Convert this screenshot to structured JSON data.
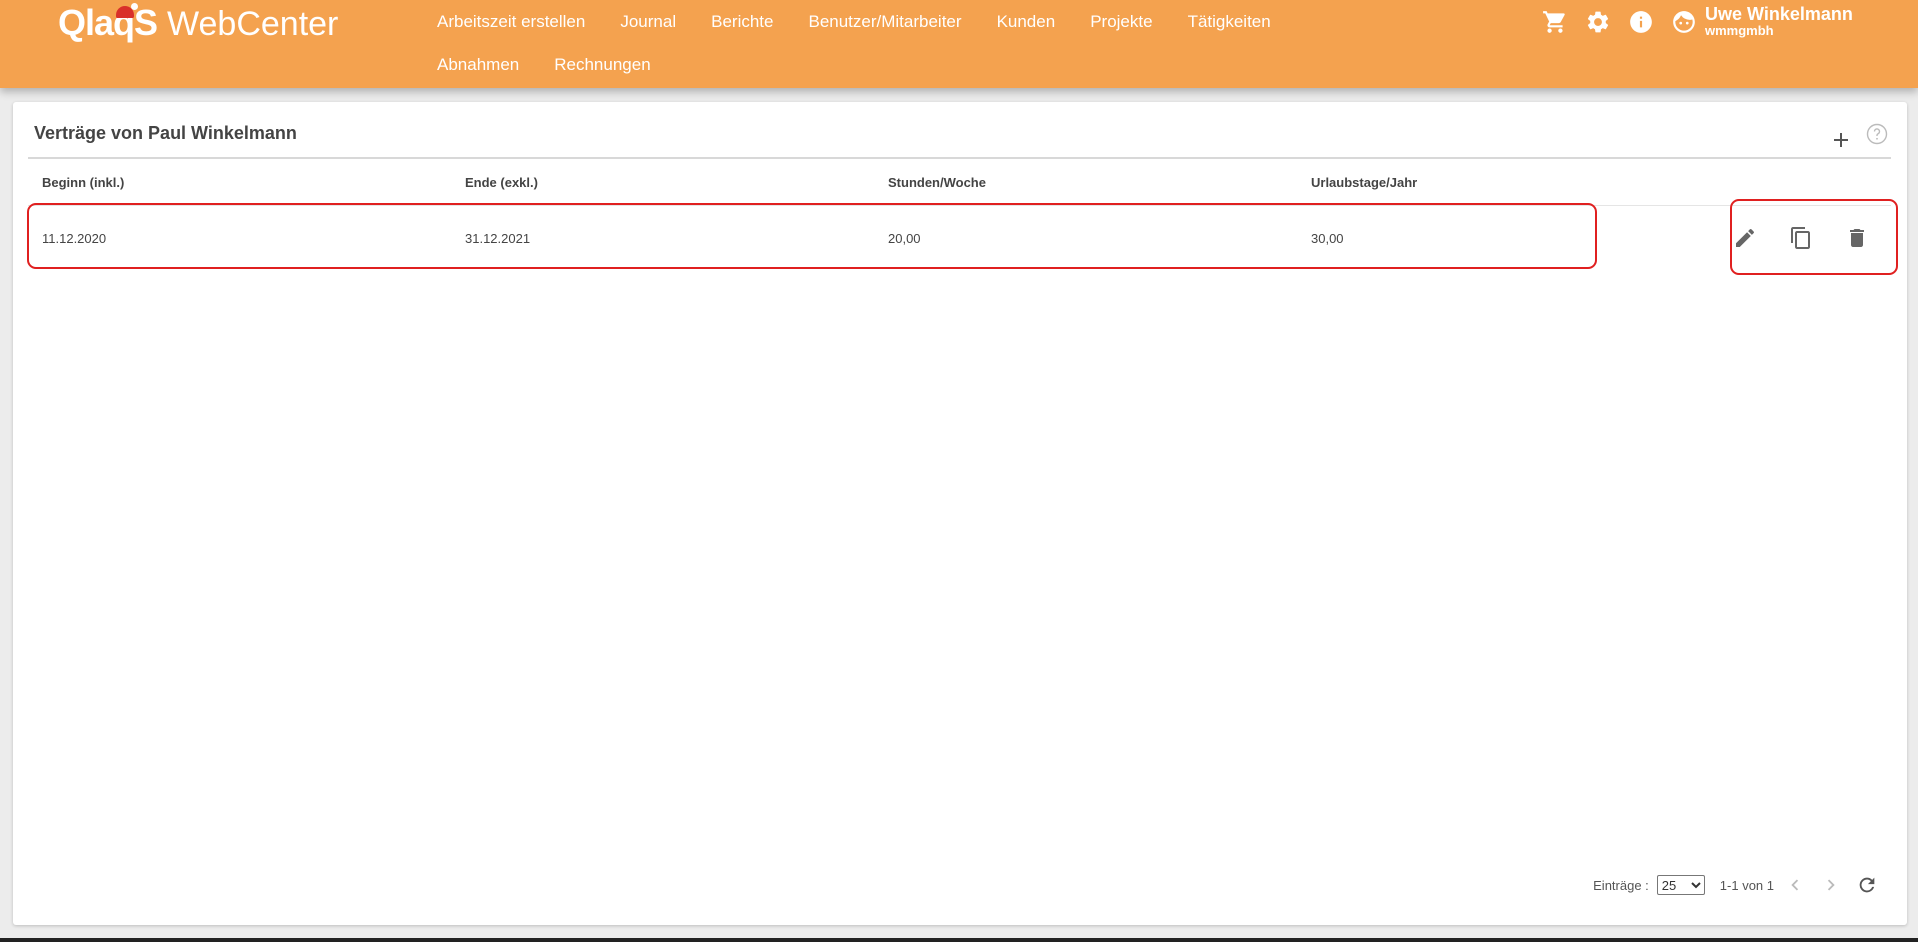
{
  "app": {
    "logo_mark": "QlaqS",
    "logo_text": "WebCenter"
  },
  "nav": {
    "items": [
      "Arbeitszeit erstellen",
      "Journal",
      "Berichte",
      "Benutzer/Mitarbeiter",
      "Kunden",
      "Projekte",
      "Tätigkeiten",
      "Abnahmen",
      "Rechnungen"
    ]
  },
  "user": {
    "name": "Uwe Winkelmann",
    "company": "wmmgmbh"
  },
  "top_icons": [
    "cart-icon",
    "gear-icon",
    "info-icon",
    "user-avatar-icon"
  ],
  "card": {
    "title": "Verträge von Paul Winkelmann"
  },
  "table": {
    "columns": [
      "Beginn (inkl.)",
      "Ende (exkl.)",
      "Stunden/Woche",
      "Urlaubstage/Jahr"
    ],
    "rows": [
      {
        "begin": "11.12.2020",
        "end": "31.12.2021",
        "hours": "20,00",
        "vacation": "30,00"
      }
    ],
    "row_actions": [
      "edit-icon",
      "copy-icon",
      "delete-icon"
    ]
  },
  "paginator": {
    "label": "Einträge :",
    "page_size": "25",
    "page_size_options": [
      "25"
    ],
    "range": "1-1 von 1"
  },
  "colors": {
    "header_bg": "#f4a24f",
    "highlight": "#e02020"
  }
}
